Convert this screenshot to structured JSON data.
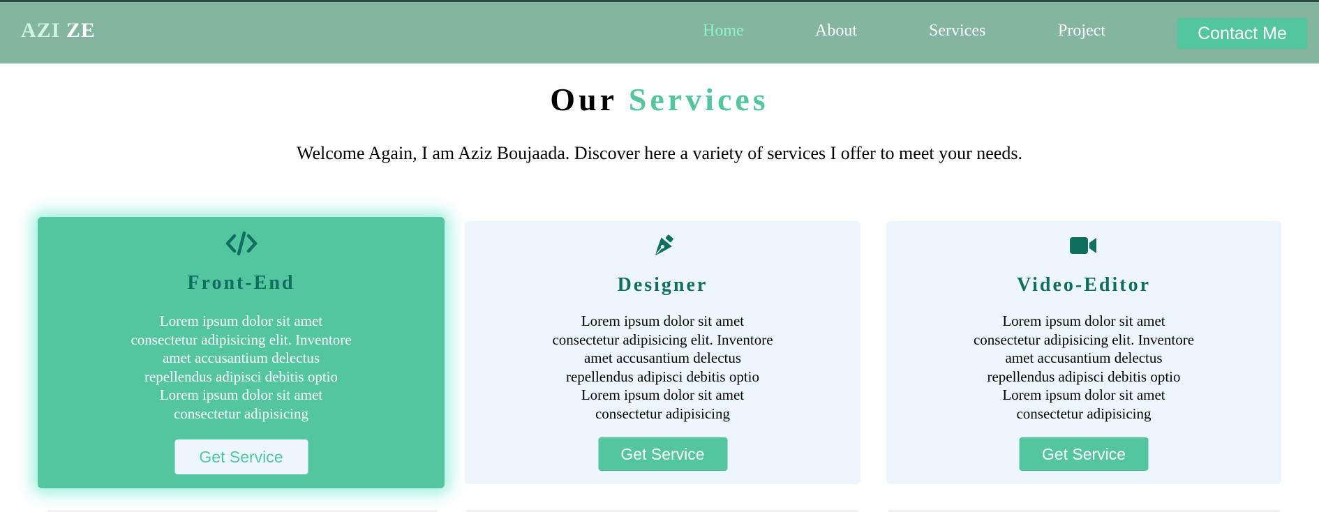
{
  "brand": {
    "part1": "AZI",
    "part2": "ZE"
  },
  "nav": {
    "links": [
      {
        "label": "Home",
        "active": true
      },
      {
        "label": "About",
        "active": false
      },
      {
        "label": "Services",
        "active": false
      },
      {
        "label": "Project",
        "active": false
      }
    ],
    "contact_label": "Contact Me"
  },
  "services": {
    "title_part1": "Our",
    "title_part2": "Services",
    "intro": "Welcome Again, I am Aziz Boujaada. Discover here a variety of services I offer to meet your needs.",
    "cards": [
      {
        "icon": "code-icon",
        "title": "Front-End",
        "text": "Lorem ipsum dolor sit amet consectetur adipisicing elit. Inventore amet accusantium delectus repellendus adipisci debitis optio Lorem ipsum dolor sit amet consectetur adipisicing",
        "button": "Get Service",
        "featured": true
      },
      {
        "icon": "pen-nib-icon",
        "title": "Designer",
        "text": "Lorem ipsum dolor sit amet consectetur adipisicing elit. Inventore amet accusantium delectus repellendus adipisci debitis optio Lorem ipsum dolor sit amet consectetur adipisicing",
        "button": "Get Service",
        "featured": false
      },
      {
        "icon": "video-camera-icon",
        "title": "Video-Editor",
        "text": "Lorem ipsum dolor sit amet consectetur adipisicing elit. Inventore amet accusantium delectus repellendus adipisci debitis optio Lorem ipsum dolor sit amet consectetur adipisicing",
        "button": "Get Service",
        "featured": false
      }
    ]
  },
  "colors": {
    "navbar": "#83b59f",
    "accent": "#53c6a0",
    "active_link": "#8ff3cc",
    "card_bg": "#edf6fd",
    "card_title": "#0f6e5e"
  }
}
